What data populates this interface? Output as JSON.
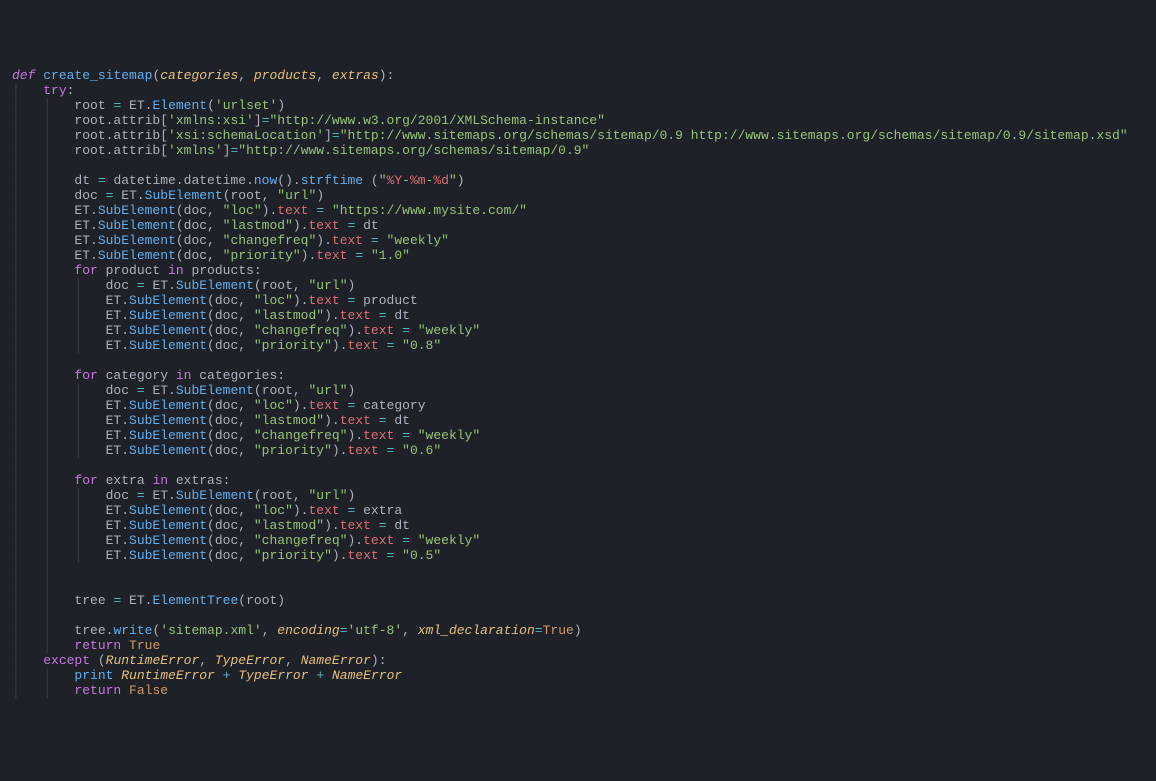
{
  "tokens": [
    [
      [
        "kw-def",
        "def "
      ],
      [
        "fn",
        "create_sitemap"
      ],
      [
        "punct",
        "("
      ],
      [
        "param",
        "categories"
      ],
      [
        "punct",
        ", "
      ],
      [
        "param",
        "products"
      ],
      [
        "punct",
        ", "
      ],
      [
        "param",
        "extras"
      ],
      [
        "punct",
        "):"
      ]
    ],
    [
      [
        "indent-guide",
        "│   "
      ],
      [
        "kw",
        "try"
      ],
      [
        "punct",
        ":"
      ]
    ],
    [
      [
        "indent-guide",
        "│   │   "
      ],
      [
        "var",
        "root "
      ],
      [
        "op",
        "="
      ],
      [
        "var",
        " ET."
      ],
      [
        "fn",
        "Element"
      ],
      [
        "punct",
        "("
      ],
      [
        "str",
        "'urlset'"
      ],
      [
        "punct",
        ")"
      ]
    ],
    [
      [
        "indent-guide",
        "│   │   "
      ],
      [
        "var",
        "root.attrib["
      ],
      [
        "str",
        "'xmlns:xsi'"
      ],
      [
        "punct",
        "]"
      ],
      [
        "op",
        "="
      ],
      [
        "str",
        "\"http://www.w3.org/2001/XMLSchema-instance\""
      ]
    ],
    [
      [
        "indent-guide",
        "│   │   "
      ],
      [
        "var",
        "root.attrib["
      ],
      [
        "str",
        "'xsi:schemaLocation'"
      ],
      [
        "punct",
        "]"
      ],
      [
        "op",
        "="
      ],
      [
        "str",
        "\"http://www.sitemaps.org/schemas/sitemap/0.9 http://www.sitemaps.org/schemas/sitemap/0.9/sitemap.xsd\""
      ]
    ],
    [
      [
        "indent-guide",
        "│   │   "
      ],
      [
        "var",
        "root.attrib["
      ],
      [
        "str",
        "'xmlns'"
      ],
      [
        "punct",
        "]"
      ],
      [
        "op",
        "="
      ],
      [
        "str",
        "\"http://www.sitemaps.org/schemas/sitemap/0.9\""
      ]
    ],
    [
      [
        "indent-guide",
        "│   │   "
      ]
    ],
    [
      [
        "indent-guide",
        "│   │   "
      ],
      [
        "var",
        "dt "
      ],
      [
        "op",
        "="
      ],
      [
        "var",
        " datetime.datetime."
      ],
      [
        "fn",
        "now"
      ],
      [
        "punct",
        "()."
      ],
      [
        "fn",
        "strftime"
      ],
      [
        "punct",
        " ("
      ],
      [
        "str",
        "\""
      ],
      [
        "strinner",
        "%Y"
      ],
      [
        "str",
        "-"
      ],
      [
        "strinner",
        "%m"
      ],
      [
        "str",
        "-"
      ],
      [
        "strinner",
        "%d"
      ],
      [
        "str",
        "\""
      ],
      [
        "punct",
        ")"
      ]
    ],
    [
      [
        "indent-guide",
        "│   │   "
      ],
      [
        "var",
        "doc "
      ],
      [
        "op",
        "="
      ],
      [
        "var",
        " ET."
      ],
      [
        "fn",
        "SubElement"
      ],
      [
        "punct",
        "(root, "
      ],
      [
        "str",
        "\"url\""
      ],
      [
        "punct",
        ")"
      ]
    ],
    [
      [
        "indent-guide",
        "│   │   "
      ],
      [
        "var",
        "ET."
      ],
      [
        "fn",
        "SubElement"
      ],
      [
        "punct",
        "(doc, "
      ],
      [
        "str",
        "\"loc\""
      ],
      [
        "punct",
        ")."
      ],
      [
        "attr",
        "text"
      ],
      [
        "var",
        " "
      ],
      [
        "op",
        "="
      ],
      [
        "var",
        " "
      ],
      [
        "str",
        "\"https://www.mysite.com/\""
      ]
    ],
    [
      [
        "indent-guide",
        "│   │   "
      ],
      [
        "var",
        "ET."
      ],
      [
        "fn",
        "SubElement"
      ],
      [
        "punct",
        "(doc, "
      ],
      [
        "str",
        "\"lastmod\""
      ],
      [
        "punct",
        ")."
      ],
      [
        "attr",
        "text"
      ],
      [
        "var",
        " "
      ],
      [
        "op",
        "="
      ],
      [
        "var",
        " dt"
      ]
    ],
    [
      [
        "indent-guide",
        "│   │   "
      ],
      [
        "var",
        "ET."
      ],
      [
        "fn",
        "SubElement"
      ],
      [
        "punct",
        "(doc, "
      ],
      [
        "str",
        "\"changefreq\""
      ],
      [
        "punct",
        ")."
      ],
      [
        "attr",
        "text"
      ],
      [
        "var",
        " "
      ],
      [
        "op",
        "="
      ],
      [
        "var",
        " "
      ],
      [
        "str",
        "\"weekly\""
      ]
    ],
    [
      [
        "indent-guide",
        "│   │   "
      ],
      [
        "var",
        "ET."
      ],
      [
        "fn",
        "SubElement"
      ],
      [
        "punct",
        "(doc, "
      ],
      [
        "str",
        "\"priority\""
      ],
      [
        "punct",
        ")."
      ],
      [
        "attr",
        "text"
      ],
      [
        "var",
        " "
      ],
      [
        "op",
        "="
      ],
      [
        "var",
        " "
      ],
      [
        "str",
        "\"1.0\""
      ]
    ],
    [
      [
        "indent-guide",
        "│   │   "
      ],
      [
        "kw",
        "for"
      ],
      [
        "var",
        " product "
      ],
      [
        "kw",
        "in"
      ],
      [
        "var",
        " products:"
      ]
    ],
    [
      [
        "indent-guide",
        "│   │   │   "
      ],
      [
        "var",
        "doc "
      ],
      [
        "op",
        "="
      ],
      [
        "var",
        " ET."
      ],
      [
        "fn",
        "SubElement"
      ],
      [
        "punct",
        "(root, "
      ],
      [
        "str",
        "\"url\""
      ],
      [
        "punct",
        ")"
      ]
    ],
    [
      [
        "indent-guide",
        "│   │   │   "
      ],
      [
        "var",
        "ET."
      ],
      [
        "fn",
        "SubElement"
      ],
      [
        "punct",
        "(doc, "
      ],
      [
        "str",
        "\"loc\""
      ],
      [
        "punct",
        ")."
      ],
      [
        "attr",
        "text"
      ],
      [
        "var",
        " "
      ],
      [
        "op",
        "="
      ],
      [
        "var",
        " product"
      ]
    ],
    [
      [
        "indent-guide",
        "│   │   │   "
      ],
      [
        "var",
        "ET."
      ],
      [
        "fn",
        "SubElement"
      ],
      [
        "punct",
        "(doc, "
      ],
      [
        "str",
        "\"lastmod\""
      ],
      [
        "punct",
        ")."
      ],
      [
        "attr",
        "text"
      ],
      [
        "var",
        " "
      ],
      [
        "op",
        "="
      ],
      [
        "var",
        " dt"
      ]
    ],
    [
      [
        "indent-guide",
        "│   │   │   "
      ],
      [
        "var",
        "ET."
      ],
      [
        "fn",
        "SubElement"
      ],
      [
        "punct",
        "(doc, "
      ],
      [
        "str",
        "\"changefreq\""
      ],
      [
        "punct",
        ")."
      ],
      [
        "attr",
        "text"
      ],
      [
        "var",
        " "
      ],
      [
        "op",
        "="
      ],
      [
        "var",
        " "
      ],
      [
        "str",
        "\"weekly\""
      ]
    ],
    [
      [
        "indent-guide",
        "│   │   │   "
      ],
      [
        "var",
        "ET."
      ],
      [
        "fn",
        "SubElement"
      ],
      [
        "punct",
        "(doc, "
      ],
      [
        "str",
        "\"priority\""
      ],
      [
        "punct",
        ")."
      ],
      [
        "attr",
        "text"
      ],
      [
        "var",
        " "
      ],
      [
        "op",
        "="
      ],
      [
        "var",
        " "
      ],
      [
        "str",
        "\"0.8\""
      ]
    ],
    [
      [
        "indent-guide",
        "│   │   "
      ]
    ],
    [
      [
        "indent-guide",
        "│   │   "
      ],
      [
        "kw",
        "for"
      ],
      [
        "var",
        " category "
      ],
      [
        "kw",
        "in"
      ],
      [
        "var",
        " categories:"
      ]
    ],
    [
      [
        "indent-guide",
        "│   │   │   "
      ],
      [
        "var",
        "doc "
      ],
      [
        "op",
        "="
      ],
      [
        "var",
        " ET."
      ],
      [
        "fn",
        "SubElement"
      ],
      [
        "punct",
        "(root, "
      ],
      [
        "str",
        "\"url\""
      ],
      [
        "punct",
        ")"
      ]
    ],
    [
      [
        "indent-guide",
        "│   │   │   "
      ],
      [
        "var",
        "ET."
      ],
      [
        "fn",
        "SubElement"
      ],
      [
        "punct",
        "(doc, "
      ],
      [
        "str",
        "\"loc\""
      ],
      [
        "punct",
        ")."
      ],
      [
        "attr",
        "text"
      ],
      [
        "var",
        " "
      ],
      [
        "op",
        "="
      ],
      [
        "var",
        " category"
      ]
    ],
    [
      [
        "indent-guide",
        "│   │   │   "
      ],
      [
        "var",
        "ET."
      ],
      [
        "fn",
        "SubElement"
      ],
      [
        "punct",
        "(doc, "
      ],
      [
        "str",
        "\"lastmod\""
      ],
      [
        "punct",
        ")."
      ],
      [
        "attr",
        "text"
      ],
      [
        "var",
        " "
      ],
      [
        "op",
        "="
      ],
      [
        "var",
        " dt"
      ]
    ],
    [
      [
        "indent-guide",
        "│   │   │   "
      ],
      [
        "var",
        "ET."
      ],
      [
        "fn",
        "SubElement"
      ],
      [
        "punct",
        "(doc, "
      ],
      [
        "str",
        "\"changefreq\""
      ],
      [
        "punct",
        ")."
      ],
      [
        "attr",
        "text"
      ],
      [
        "var",
        " "
      ],
      [
        "op",
        "="
      ],
      [
        "var",
        " "
      ],
      [
        "str",
        "\"weekly\""
      ]
    ],
    [
      [
        "indent-guide",
        "│   │   │   "
      ],
      [
        "var",
        "ET."
      ],
      [
        "fn",
        "SubElement"
      ],
      [
        "punct",
        "(doc, "
      ],
      [
        "str",
        "\"priority\""
      ],
      [
        "punct",
        ")."
      ],
      [
        "attr",
        "text"
      ],
      [
        "var",
        " "
      ],
      [
        "op",
        "="
      ],
      [
        "var",
        " "
      ],
      [
        "str",
        "\"0.6\""
      ]
    ],
    [
      [
        "indent-guide",
        "│   │   "
      ]
    ],
    [
      [
        "indent-guide",
        "│   │   "
      ],
      [
        "kw",
        "for"
      ],
      [
        "var",
        " extra "
      ],
      [
        "kw",
        "in"
      ],
      [
        "var",
        " extras:"
      ]
    ],
    [
      [
        "indent-guide",
        "│   │   │   "
      ],
      [
        "var",
        "doc "
      ],
      [
        "op",
        "="
      ],
      [
        "var",
        " ET."
      ],
      [
        "fn",
        "SubElement"
      ],
      [
        "punct",
        "(root, "
      ],
      [
        "str",
        "\"url\""
      ],
      [
        "punct",
        ")"
      ]
    ],
    [
      [
        "indent-guide",
        "│   │   │   "
      ],
      [
        "var",
        "ET."
      ],
      [
        "fn",
        "SubElement"
      ],
      [
        "punct",
        "(doc, "
      ],
      [
        "str",
        "\"loc\""
      ],
      [
        "punct",
        ")."
      ],
      [
        "attr",
        "text"
      ],
      [
        "var",
        " "
      ],
      [
        "op",
        "="
      ],
      [
        "var",
        " extra"
      ]
    ],
    [
      [
        "indent-guide",
        "│   │   │   "
      ],
      [
        "var",
        "ET."
      ],
      [
        "fn",
        "SubElement"
      ],
      [
        "punct",
        "(doc, "
      ],
      [
        "str",
        "\"lastmod\""
      ],
      [
        "punct",
        ")."
      ],
      [
        "attr",
        "text"
      ],
      [
        "var",
        " "
      ],
      [
        "op",
        "="
      ],
      [
        "var",
        " dt"
      ]
    ],
    [
      [
        "indent-guide",
        "│   │   │   "
      ],
      [
        "var",
        "ET."
      ],
      [
        "fn",
        "SubElement"
      ],
      [
        "punct",
        "(doc, "
      ],
      [
        "str",
        "\"changefreq\""
      ],
      [
        "punct",
        ")."
      ],
      [
        "attr",
        "text"
      ],
      [
        "var",
        " "
      ],
      [
        "op",
        "="
      ],
      [
        "var",
        " "
      ],
      [
        "str",
        "\"weekly\""
      ]
    ],
    [
      [
        "indent-guide",
        "│   │   │   "
      ],
      [
        "var",
        "ET."
      ],
      [
        "fn",
        "SubElement"
      ],
      [
        "punct",
        "(doc, "
      ],
      [
        "str",
        "\"priority\""
      ],
      [
        "punct",
        ")."
      ],
      [
        "attr",
        "text"
      ],
      [
        "var",
        " "
      ],
      [
        "op",
        "="
      ],
      [
        "var",
        " "
      ],
      [
        "str",
        "\"0.5\""
      ]
    ],
    [
      [
        "indent-guide",
        "│   │   "
      ]
    ],
    [
      [
        "indent-guide",
        "│   │   "
      ]
    ],
    [
      [
        "indent-guide",
        "│   │   "
      ],
      [
        "var",
        "tree "
      ],
      [
        "op",
        "="
      ],
      [
        "var",
        " ET."
      ],
      [
        "fn",
        "ElementTree"
      ],
      [
        "punct",
        "(root)"
      ]
    ],
    [
      [
        "indent-guide",
        "│   │   "
      ]
    ],
    [
      [
        "indent-guide",
        "│   │   "
      ],
      [
        "var",
        "tree."
      ],
      [
        "fn",
        "write"
      ],
      [
        "punct",
        "("
      ],
      [
        "str",
        "'sitemap.xml'"
      ],
      [
        "punct",
        ", "
      ],
      [
        "kwarg",
        "encoding"
      ],
      [
        "op",
        "="
      ],
      [
        "str",
        "'utf-8'"
      ],
      [
        "punct",
        ", "
      ],
      [
        "kwarg",
        "xml_declaration"
      ],
      [
        "op",
        "="
      ],
      [
        "true",
        "True"
      ],
      [
        "punct",
        ")"
      ]
    ],
    [
      [
        "indent-guide",
        "│   │   "
      ],
      [
        "kw",
        "return"
      ],
      [
        "var",
        " "
      ],
      [
        "true",
        "True"
      ]
    ],
    [
      [
        "indent-guide",
        "│   "
      ],
      [
        "kw",
        "except"
      ],
      [
        "punct",
        " ("
      ],
      [
        "class-ref",
        "RuntimeError"
      ],
      [
        "punct",
        ", "
      ],
      [
        "class-ref",
        "TypeError"
      ],
      [
        "punct",
        ", "
      ],
      [
        "class-ref",
        "NameError"
      ],
      [
        "punct",
        "):"
      ]
    ],
    [
      [
        "indent-guide",
        "│   │   "
      ],
      [
        "fn",
        "print"
      ],
      [
        "var",
        " "
      ],
      [
        "class-ref",
        "RuntimeError"
      ],
      [
        "var",
        " "
      ],
      [
        "op",
        "+"
      ],
      [
        "var",
        " "
      ],
      [
        "class-ref",
        "TypeError"
      ],
      [
        "var",
        " "
      ],
      [
        "op",
        "+"
      ],
      [
        "var",
        " "
      ],
      [
        "class-ref",
        "NameError"
      ]
    ],
    [
      [
        "indent-guide",
        "│   │   "
      ],
      [
        "kw",
        "return"
      ],
      [
        "var",
        " "
      ],
      [
        "true",
        "False"
      ]
    ]
  ]
}
